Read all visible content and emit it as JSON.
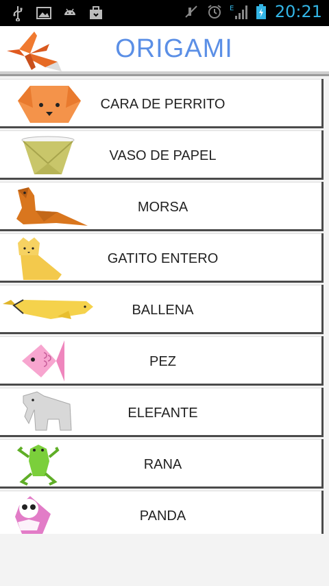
{
  "status_bar": {
    "time": "20:21",
    "network_type": "E",
    "left_icons": [
      "usb-icon",
      "image-icon",
      "android-icon",
      "briefcase-icon"
    ],
    "right_icons": [
      "mute-icon",
      "alarm-icon",
      "signal-icon",
      "battery-charging-icon"
    ],
    "accent_color": "#33b5e5"
  },
  "header": {
    "title": "ORIGAMI",
    "title_color": "#5b8fe6",
    "logo_icon": "origami-crane-icon"
  },
  "items": [
    {
      "label": "CARA DE PERRITO",
      "icon": "dog-face-icon"
    },
    {
      "label": "VASO DE PAPEL",
      "icon": "paper-cup-icon"
    },
    {
      "label": "MORSA",
      "icon": "walrus-icon"
    },
    {
      "label": "GATITO ENTERO",
      "icon": "kitten-icon"
    },
    {
      "label": "BALLENA",
      "icon": "whale-icon"
    },
    {
      "label": "PEZ",
      "icon": "fish-icon"
    },
    {
      "label": "ELEFANTE",
      "icon": "elephant-icon"
    },
    {
      "label": "RANA",
      "icon": "frog-icon"
    },
    {
      "label": "PANDA",
      "icon": "panda-icon"
    }
  ]
}
